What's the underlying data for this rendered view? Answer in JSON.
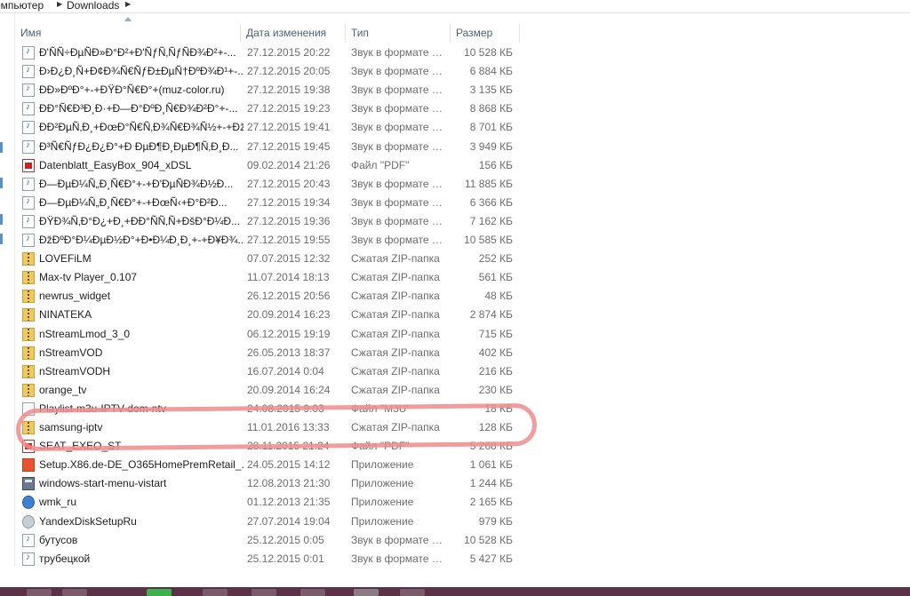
{
  "breadcrumb": {
    "parent": "омпьютер",
    "current": "Downloads"
  },
  "columns": {
    "name": "Имя",
    "date": "Дата изменения",
    "type": "Тип",
    "size": "Размер"
  },
  "files": [
    {
      "icon": "audio-file-icon",
      "name": "Ð'ÑÑ÷ÐµÑÐ»Ð°Ð²+Ð'ÑƒÑ‚ÑƒÑÐ¾Ð²+-...",
      "date": "27.12.2015 20:22",
      "type": "Звук в формате M...",
      "size": "10 528 КБ"
    },
    {
      "icon": "audio-file-icon",
      "name": "Ð›Ð¿Ð¸Ñ+Ð¢Ð¾Ñ€ÑƒÐ±ÐµÑ†ÐºÐ¾Ð¹+-...",
      "date": "27.12.2015 20:05",
      "type": "Звук в формате M...",
      "size": "6 884 КБ"
    },
    {
      "icon": "audio-file-icon",
      "name": "ÐÐ»ÐºÐ°+-+ÐŸÐ°Ñ€Ð°+(muz-color.ru)",
      "date": "27.12.2015 19:38",
      "type": "Звук в формате M...",
      "size": "3 135 КБ"
    },
    {
      "icon": "audio-file-icon",
      "name": "ÐÐ°Ñ€Ð³Ð¸Ð·+Ð—Ð°ÐºÐ¸Ñ€Ð¾Ð²Ð°+-...",
      "date": "27.12.2015 19:23",
      "type": "Звук в формате M...",
      "size": "8 868 КБ"
    },
    {
      "icon": "audio-file-icon",
      "name": "ÐÐ²ÐµÑ‚Ð¸+ÐœÐ°Ñ€Ñ‚Ð¾Ñ€Ð¾Ñ½+-+Ðž...",
      "date": "27.12.2015 19:41",
      "type": "Звук в формате M...",
      "size": "8 701 КБ"
    },
    {
      "icon": "audio-file-icon",
      "name": "Ð³Ñ€ÑƒÐ¿Ð¿Ð°+Ð ÐµÐ¶Ð¸ÐµÐ¶Ñ‚Ð¸Ð...",
      "date": "27.12.2015 19:45",
      "type": "Звук в формате M...",
      "size": "3 949 КБ"
    },
    {
      "icon": "pdf-file-icon",
      "name": "Datenblatt_EasyBox_904_xDSL",
      "date": "09.02.2014 21:26",
      "type": "Файл \"PDF\"",
      "size": "156 КБ"
    },
    {
      "icon": "audio-file-icon",
      "name": "Ð—ÐµÐ¼Ñ„Ð¸Ñ€Ð°+-+Ð'ÐµÑÐ¾Ð½Ð...",
      "date": "27.12.2015 20:43",
      "type": "Звук в формате M...",
      "size": "11 885 КБ"
    },
    {
      "icon": "audio-file-icon",
      "name": "Ð—ÐµÐ¼Ñ„Ð¸Ñ€Ð°+-+ÐœÑ‹+Ð°Ð²Ð...",
      "date": "27.12.2015 19:34",
      "type": "Звук в формате M...",
      "size": "6 366 КБ"
    },
    {
      "icon": "audio-file-icon",
      "name": "ÐŸÐ¾Ñ‚Ð°Ð¿+Ð¸+ÐÐ°ÑÑ‚Ñ+ÐšÐ°Ð¼Ð...",
      "date": "27.12.2015 19:36",
      "type": "Звук в формате M...",
      "size": "7 162 КБ"
    },
    {
      "icon": "audio-file-icon",
      "name": "ÐžÐºÐ°Ð¼ÐµÐ½Ð°+Ð•Ð¼Ð¸Ð¸+-+Ð¥Ð¾...",
      "date": "27.12.2015 19:55",
      "type": "Звук в формате M...",
      "size": "10 585 КБ"
    },
    {
      "icon": "zip-folder-icon",
      "name": "LOVEFiLM",
      "date": "07.07.2015 12:32",
      "type": "Сжатая ZIP-папка",
      "size": "252 КБ"
    },
    {
      "icon": "zip-folder-icon",
      "name": "Max-tv Player_0.107",
      "date": "11.07.2014 18:13",
      "type": "Сжатая ZIP-папка",
      "size": "561 КБ"
    },
    {
      "icon": "zip-folder-icon",
      "name": "newrus_widget",
      "date": "26.12.2015 20:56",
      "type": "Сжатая ZIP-папка",
      "size": "48 КБ"
    },
    {
      "icon": "zip-folder-icon",
      "name": "NINATEKA",
      "date": "20.09.2014 16:23",
      "type": "Сжатая ZIP-папка",
      "size": "2 874 КБ"
    },
    {
      "icon": "zip-folder-icon",
      "name": "nStreamLmod_3_0",
      "date": "06.12.2015 19:19",
      "type": "Сжатая ZIP-папка",
      "size": "715 КБ"
    },
    {
      "icon": "zip-folder-icon",
      "name": "nStreamVOD",
      "date": "26.05.2013 18:37",
      "type": "Сжатая ZIP-папка",
      "size": "402 КБ"
    },
    {
      "icon": "zip-folder-icon",
      "name": "nStreamVODH",
      "date": "16.07.2014 0:04",
      "type": "Сжатая ZIP-папка",
      "size": "216 КБ"
    },
    {
      "icon": "zip-folder-icon",
      "name": "orange_tv",
      "date": "20.09.2014 16:24",
      "type": "Сжатая ZIP-папка",
      "size": "230 КБ"
    },
    {
      "icon": "playlist-file-icon",
      "name": "Playlist-m3u-IPTV-dom-ntv",
      "date": "24.08.2015 9:03",
      "type": "Файл \"M3U\"",
      "size": "18 КБ"
    },
    {
      "icon": "zip-folder-icon",
      "name": "samsung-iptv",
      "date": "11.01.2016 13:33",
      "type": "Сжатая ZIP-папка",
      "size": "128 КБ"
    },
    {
      "icon": "pdf-file-icon",
      "name": "SEAT_EXEO_ST",
      "date": "28.11.2015 21:24",
      "type": "Файл \"PDF\"",
      "size": "5 268 КБ"
    },
    {
      "icon": "office-installer-icon",
      "name": "Setup.X86.de-DE_O365HomePremRetail_...",
      "date": "24.05.2015 14:12",
      "type": "Приложение",
      "size": "1 061 КБ"
    },
    {
      "icon": "application-icon",
      "name": "windows-start-menu-vistart",
      "date": "12.08.2013 21:30",
      "type": "Приложение",
      "size": "1 244 КБ"
    },
    {
      "icon": "globe-app-icon",
      "name": "wmk_ru",
      "date": "01.12.2013 21:35",
      "type": "Приложение",
      "size": "2 165 КБ"
    },
    {
      "icon": "disk-setup-icon",
      "name": "YandexDiskSetupRu",
      "date": "27.07.2014 19:04",
      "type": "Приложение",
      "size": "979 КБ"
    },
    {
      "icon": "audio-file-icon",
      "name": "бутусов",
      "date": "25.12.2015 0:05",
      "type": "Звук в формате M...",
      "size": "10 528 КБ"
    },
    {
      "icon": "audio-file-icon",
      "name": "трубецкой",
      "date": "25.12.2015 0:01",
      "type": "Звук в формате M...",
      "size": "5 427 КБ"
    }
  ],
  "accent_color": "#f08c8c",
  "highlighted_file": "samsung-iptv"
}
